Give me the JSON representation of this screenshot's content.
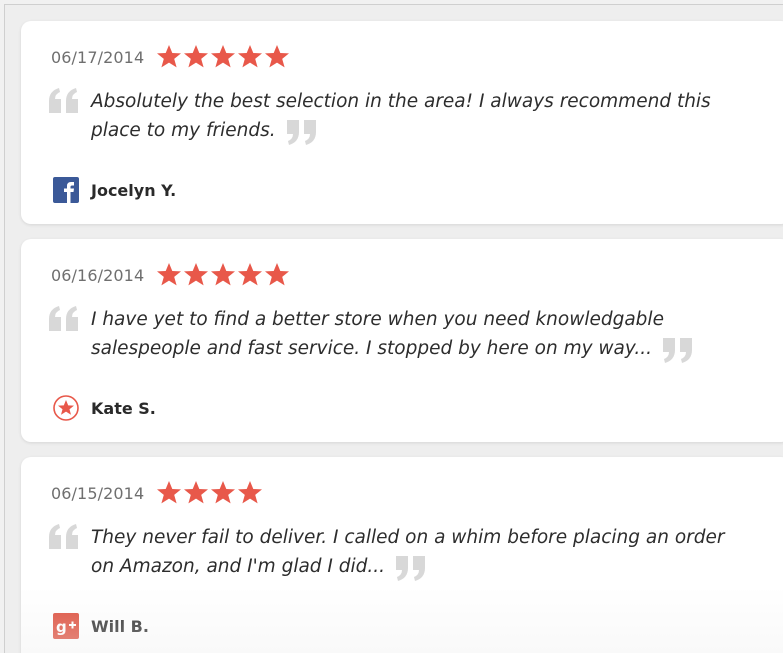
{
  "colors": {
    "star": "#e8584a",
    "quote_mark": "#d8d8d8",
    "facebook": "#3b5998",
    "google_plus": "#dd4b39",
    "site": "#e8584a"
  },
  "reviews": [
    {
      "date": "06/17/2014",
      "rating": 5,
      "text": "Absolutely the best selection in the area! I always recommend this place to my friends.",
      "author": "Jocelyn Y.",
      "source_icon": "facebook-icon"
    },
    {
      "date": "06/16/2014",
      "rating": 5,
      "text": "I have yet to find a better store when you need knowledgable salespeople and fast service. I stopped by here on my way...",
      "author": "Kate S.",
      "source_icon": "star-badge-icon"
    },
    {
      "date": "06/15/2014",
      "rating": 4,
      "text": "They never fail to deliver. I called on a whim before placing an order on Amazon, and I'm glad I did...",
      "author": "Will B.",
      "source_icon": "google-plus-icon"
    }
  ]
}
